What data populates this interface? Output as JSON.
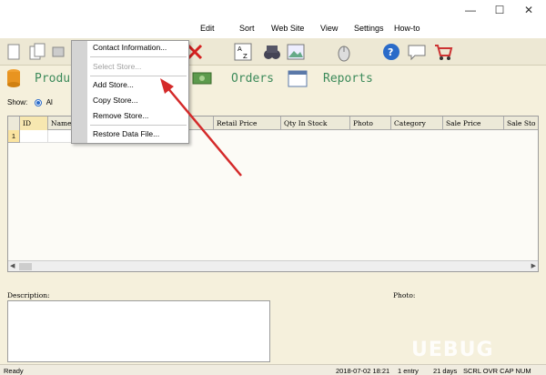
{
  "window": {
    "minimize": "—",
    "maximize": "☐",
    "close": "✕"
  },
  "menu": [
    "Edit",
    "Sort",
    "Web Site",
    "View",
    "Settings",
    "How-to"
  ],
  "nav": {
    "products": "Produ",
    "orders": "Orders",
    "reports": "Reports"
  },
  "show": {
    "label": "Show:",
    "option_all": "Al"
  },
  "grid": {
    "columns": [
      "ID",
      "Name",
      "",
      "Retail Price",
      "Qty In Stock",
      "Photo",
      "Category",
      "Sale Price",
      "Sale Sto"
    ],
    "row_number": "1"
  },
  "description_label": "Description:",
  "photo_label": "Photo:",
  "dropdown": {
    "items": [
      "Contact Information...",
      "Select Store...",
      "Add Store...",
      "Copy Store...",
      "Remove Store...",
      "Restore Data File..."
    ]
  },
  "status": {
    "ready": "Ready",
    "datetime": "2018-07-02 18:21",
    "entries": "1 entry",
    "days": "21 days",
    "indicators": "SCRL OVR CAP NUM"
  },
  "watermark": "UEBUG",
  "colors": {
    "nav_text": "#3c8a5a",
    "arrow": "#d42a2a",
    "background": "#f5f0dc"
  }
}
